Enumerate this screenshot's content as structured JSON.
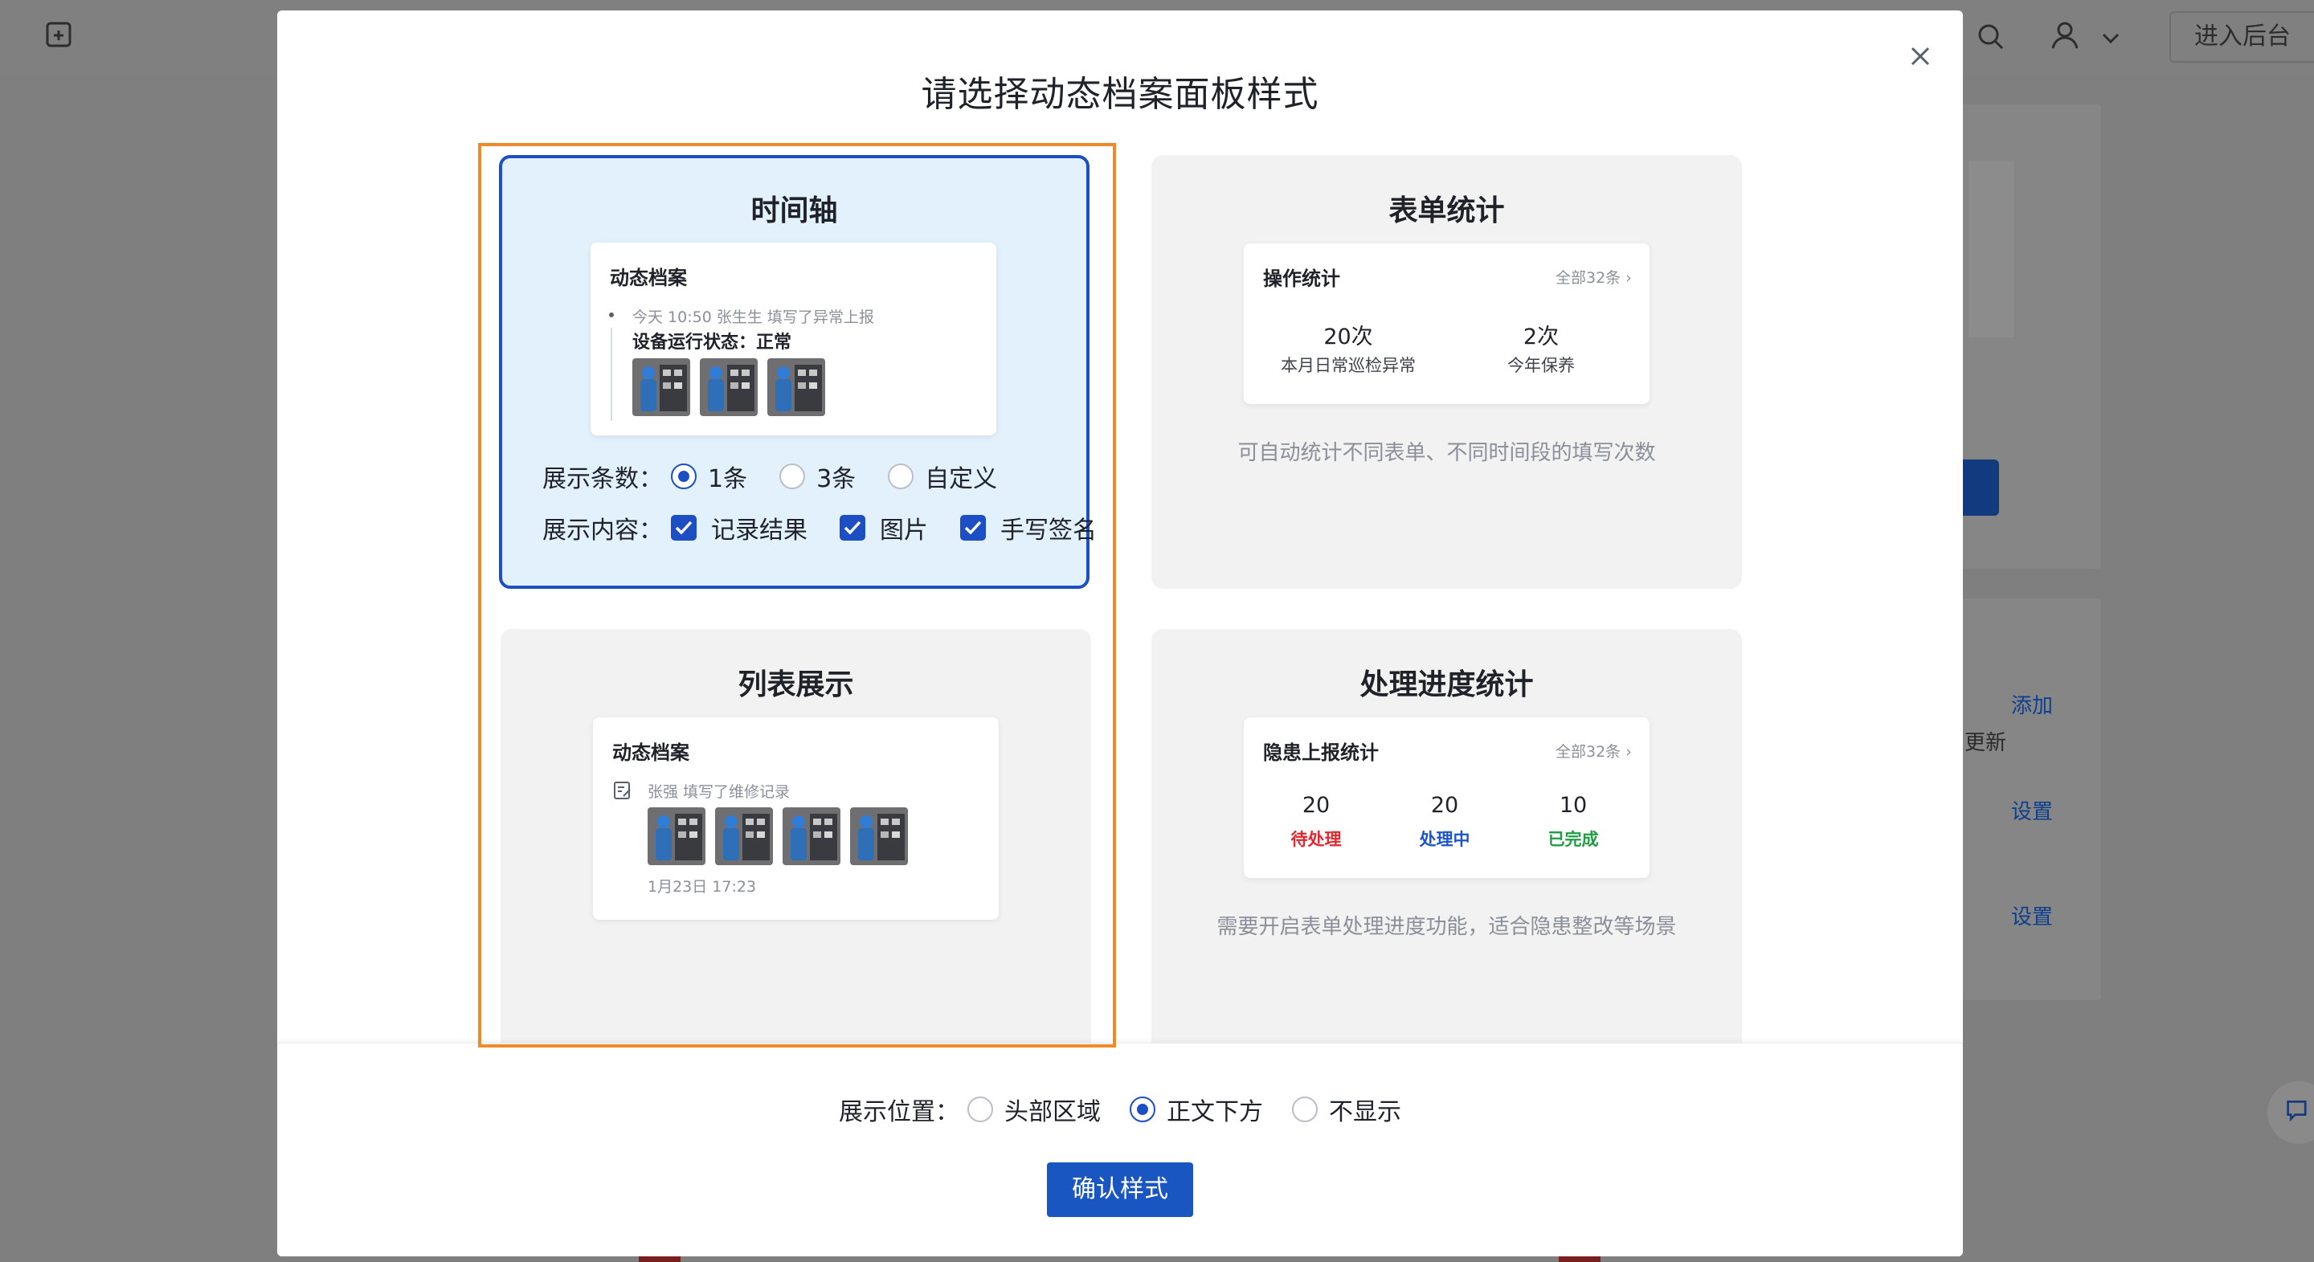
{
  "background": {
    "enter_backend": "进入后台",
    "link_add": "添加",
    "text_update": "更新",
    "link_settings_1": "设置",
    "link_settings_2": "设置"
  },
  "modal": {
    "title": "请选择动态档案面板样式",
    "close_icon": "close-icon"
  },
  "cards": {
    "timeline": {
      "title": "时间轴",
      "preview": {
        "head": "动态档案",
        "meta": "今天 10:50   张生生  填写了异常上报",
        "status": "设备运行状态：正常"
      },
      "count_label": "展示条数：",
      "count_options": [
        "1条",
        "3条",
        "自定义"
      ],
      "count_selected": "1条",
      "content_label": "展示内容：",
      "content_options": [
        "记录结果",
        "图片",
        "手写签名"
      ]
    },
    "form_stats": {
      "title": "表单统计",
      "preview": {
        "head": "操作统计",
        "more": "全部32条",
        "stats": [
          {
            "value": "20次",
            "label": "本月日常巡检异常"
          },
          {
            "value": "2次",
            "label": "今年保养"
          }
        ]
      },
      "desc": "可自动统计不同表单、不同时间段的填写次数"
    },
    "list": {
      "title": "列表展示",
      "preview": {
        "head": "动态档案",
        "meta": "张强  填写了维修记录",
        "date": "1月23日 17:23"
      }
    },
    "progress": {
      "title": "处理进度统计",
      "preview": {
        "head": "隐患上报统计",
        "more": "全部32条",
        "stats": [
          {
            "value": "20",
            "label": "待处理",
            "color": "#e5262e"
          },
          {
            "value": "20",
            "label": "处理中",
            "color": "#1d55c9"
          },
          {
            "value": "10",
            "label": "已完成",
            "color": "#1f9d43"
          }
        ]
      },
      "desc": "需要开启表单处理进度功能，适合隐患整改等场景"
    }
  },
  "footer": {
    "position_label": "展示位置：",
    "position_options": [
      "头部区域",
      "正文下方",
      "不显示"
    ],
    "position_selected": "正文下方",
    "confirm_label": "确认样式"
  },
  "colors": {
    "accent": "#1d4fc4",
    "selection_frame": "#ee8a2a",
    "selected_card_bg": "#e3f1fd"
  }
}
